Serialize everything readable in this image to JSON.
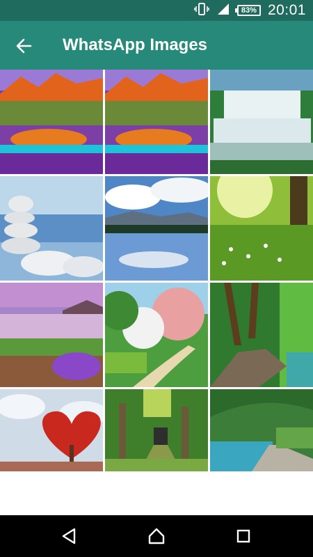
{
  "status_bar": {
    "time": "20:01",
    "battery_level": "83%",
    "icons": [
      "vibrate-icon",
      "signal-icon",
      "battery-icon"
    ]
  },
  "app_bar": {
    "title": "WhatsApp Images",
    "back_icon": "arrow-left-icon",
    "background_color": "#26897a",
    "status_color": "#1f6b5e"
  },
  "gallery": {
    "images": [
      {
        "name": "image-mountain-flowers-lake"
      },
      {
        "name": "image-mountain-flowers-lake-2"
      },
      {
        "name": "image-waterfalls"
      },
      {
        "name": "image-stacked-stones"
      },
      {
        "name": "image-lake-reflection"
      },
      {
        "name": "image-sunlit-meadow"
      },
      {
        "name": "image-purple-flowers-lake"
      },
      {
        "name": "image-blossom-trees-path"
      },
      {
        "name": "image-forest-path"
      },
      {
        "name": "image-heart-tree"
      },
      {
        "name": "image-tree-tunnel"
      },
      {
        "name": "image-boardwalk-lake"
      }
    ]
  },
  "nav_bar": {
    "buttons": [
      "back-triangle-icon",
      "home-circle-icon",
      "recents-square-icon"
    ]
  }
}
